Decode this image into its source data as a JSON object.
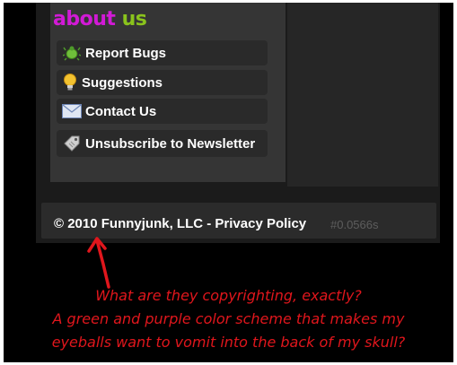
{
  "about": {
    "word1": "about",
    "word2": "us",
    "color_word1": "#d21ad6",
    "color_word2": "#8ac31c"
  },
  "menu": [
    {
      "label": "Report Bugs",
      "icon": "bug-icon"
    },
    {
      "label": "Suggestions",
      "icon": "lightbulb-icon"
    },
    {
      "label": "Contact Us",
      "icon": "envelope-icon"
    },
    {
      "label": "Unsubscribe to Newsletter",
      "icon": "tag-icon"
    }
  ],
  "footer": {
    "copyright": "© 2010 Funnyjunk, LLC - Privacy Policy",
    "timing": "#0.0566s"
  },
  "annotation": {
    "lines": [
      "What are they copyrighting, exactly?",
      "A green and purple color scheme that makes my",
      "eyeballs want to vomit into the back of my skull?"
    ],
    "color": "#e0161c"
  }
}
